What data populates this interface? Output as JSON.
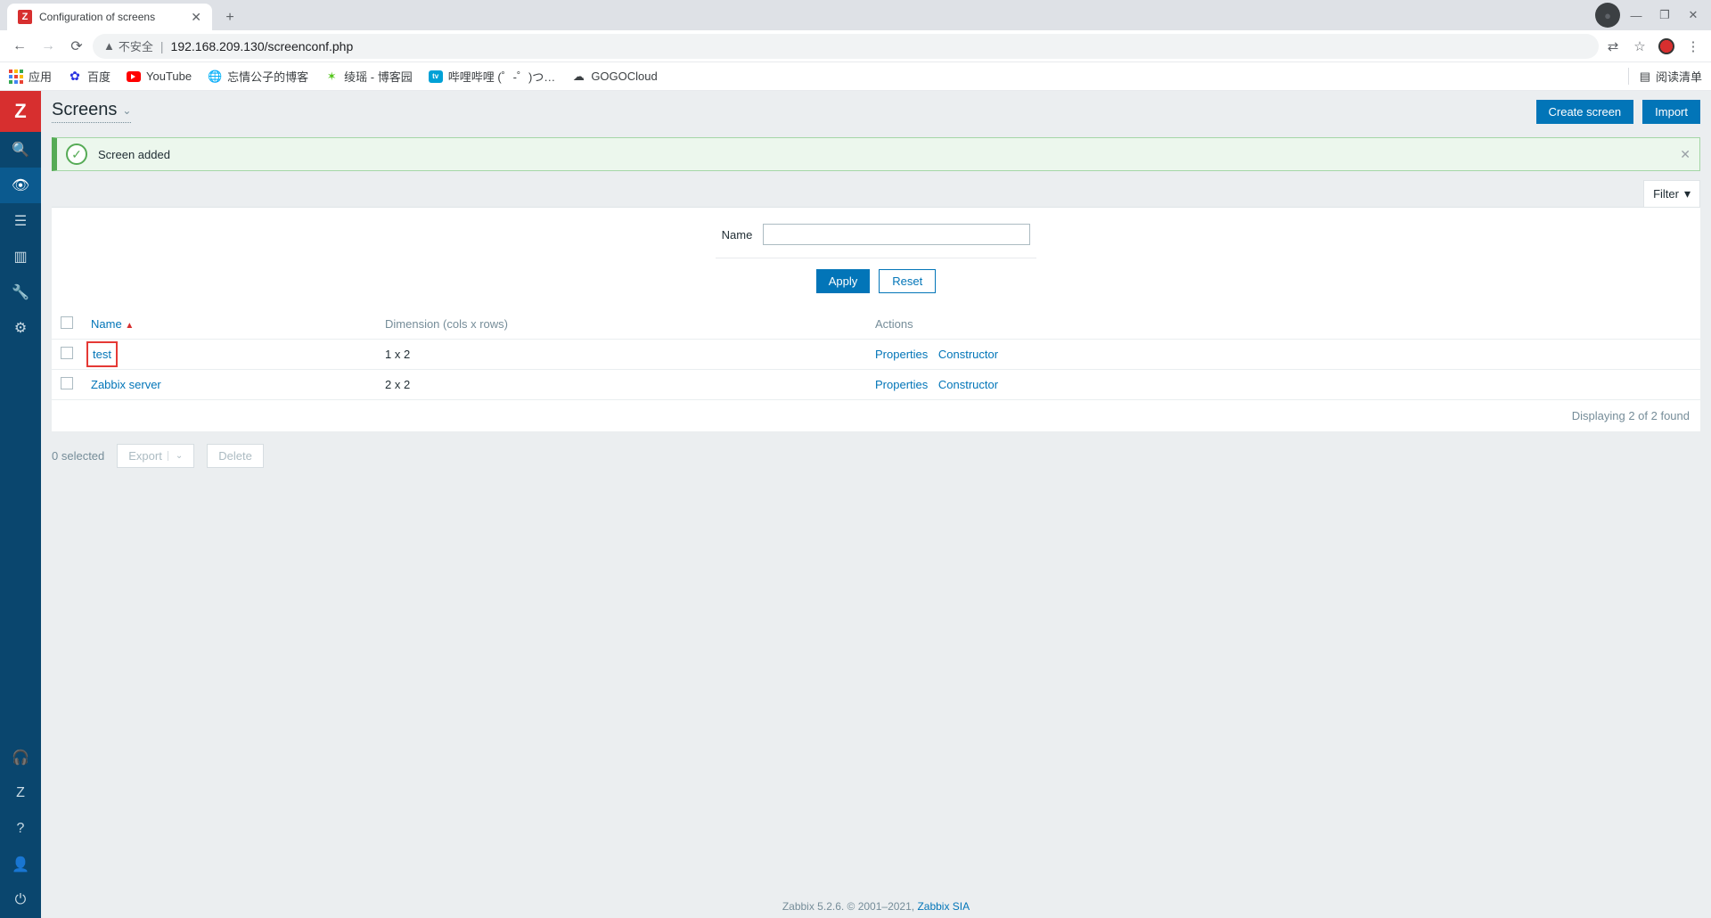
{
  "browser": {
    "tab_title": "Configuration of screens",
    "url_insecure_label": "不安全",
    "url": "192.168.209.130/screenconf.php",
    "window_controls": {
      "minimize": "—",
      "maximize": "❐",
      "close": "✕"
    }
  },
  "bookmarks": {
    "apps": "应用",
    "items": [
      {
        "label": "百度",
        "icon": "baidu"
      },
      {
        "label": "YouTube",
        "icon": "youtube"
      },
      {
        "label": "忘情公子的博客",
        "icon": "globe"
      },
      {
        "label": "绫瑶 - 博客园",
        "icon": "globe-green"
      },
      {
        "label": "哔哩哔哩 (゜-゜)つ…",
        "icon": "bili"
      },
      {
        "label": "GOGOCloud",
        "icon": "cloud"
      }
    ],
    "reading_list": "阅读清单"
  },
  "sidebar": {
    "logo": "Z",
    "items": [
      {
        "name": "search",
        "glyph": "🔍"
      },
      {
        "name": "monitoring",
        "glyph": "👁",
        "active": true
      },
      {
        "name": "inventory",
        "glyph": "☰"
      },
      {
        "name": "reports",
        "glyph": "▥"
      },
      {
        "name": "config",
        "glyph": "🔧"
      },
      {
        "name": "admin",
        "glyph": "⚙"
      }
    ],
    "bottom": [
      {
        "name": "support",
        "glyph": "🎧"
      },
      {
        "name": "share",
        "glyph": "Z"
      },
      {
        "name": "help",
        "glyph": "?"
      },
      {
        "name": "user",
        "glyph": "👤"
      },
      {
        "name": "signout",
        "glyph": "⏻"
      }
    ]
  },
  "page": {
    "title": "Screens",
    "create_btn": "Create screen",
    "import_btn": "Import"
  },
  "alert": {
    "text": "Screen added"
  },
  "filter": {
    "tab_label": "Filter",
    "name_label": "Name",
    "name_value": "",
    "apply": "Apply",
    "reset": "Reset"
  },
  "table": {
    "headers": {
      "name": "Name",
      "dimension": "Dimension (cols x rows)",
      "actions": "Actions"
    },
    "action_labels": {
      "properties": "Properties",
      "constructor": "Constructor"
    },
    "rows": [
      {
        "name": "test",
        "dimension": "1 x 2",
        "highlight": true
      },
      {
        "name": "Zabbix server",
        "dimension": "2 x 2",
        "highlight": false
      }
    ],
    "footer": "Displaying 2 of 2 found"
  },
  "bulk": {
    "selected": "0 selected",
    "export": "Export",
    "delete": "Delete"
  },
  "footer": {
    "text": "Zabbix 5.2.6. © 2001–2021, ",
    "link": "Zabbix SIA"
  }
}
